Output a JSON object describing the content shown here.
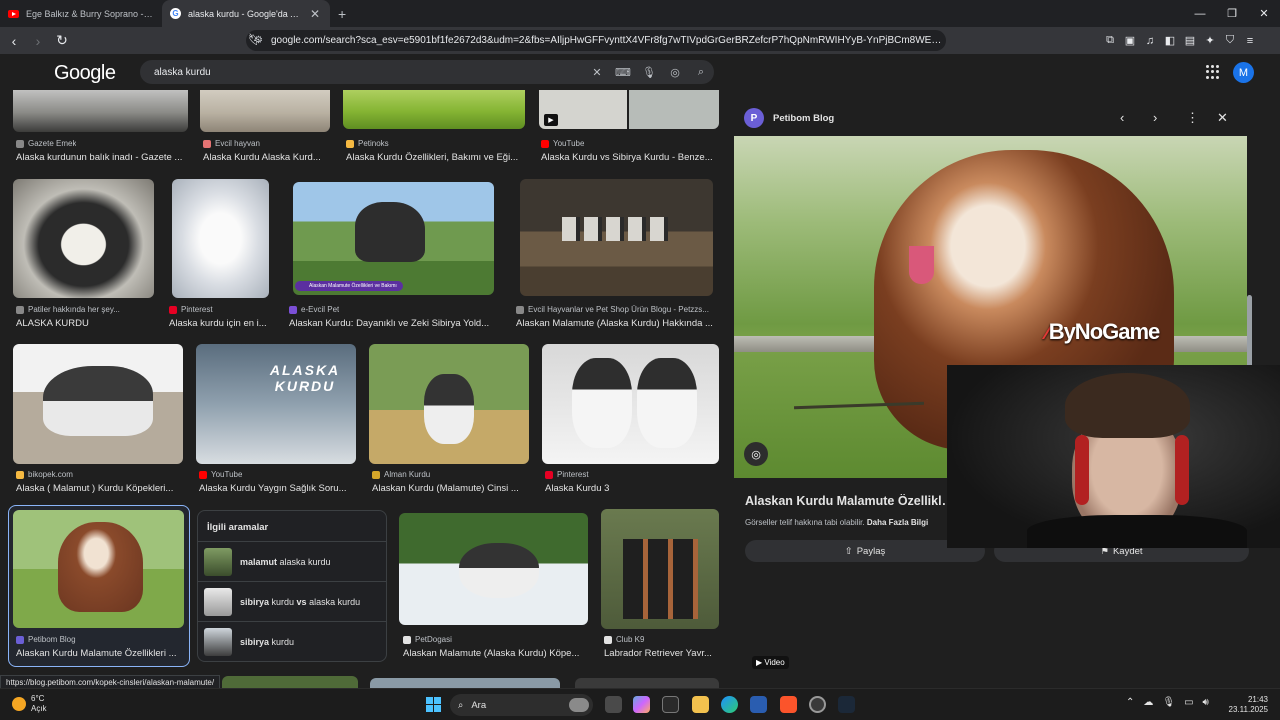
{
  "tabs": [
    {
      "title": "Ege Balkız & Burry Soprano - Affet Be",
      "active": false
    },
    {
      "title": "alaska kurdu - Google'da Ara",
      "active": true
    }
  ],
  "address_bar": {
    "url": "google.com/search?sca_esv=e5901bf1fe2672d3&udm=2&fbs=AIljpHwGFFvynttX4VFr8fg7wTIVpdGrGerBRZefcrP7hQpNmRWIHYyB-YnPjBCm8WEEt..."
  },
  "google": {
    "logo": "Google",
    "query": "alaska kurdu",
    "avatar_letter": "M"
  },
  "results": [
    {
      "source": "Gazete Emek",
      "title": "Alaska kurdunun balık inadı - Gazete ..."
    },
    {
      "source": "Evcil hayvan",
      "title": "Alaska Kurdu Alaska Kurd..."
    },
    {
      "source": "Petinoks",
      "title": "Alaska Kurdu Özellikleri, Bakımı ve Eği..."
    },
    {
      "source": "YouTube",
      "title": "Alaska Kurdu vs Sibirya Kurdu - Benze..."
    },
    {
      "source": "Patiler hakkında her şey...",
      "title": "ALASKA KURDU"
    },
    {
      "source": "Pinterest",
      "title": "Alaska kurdu için en i..."
    },
    {
      "source": "e-Evcil Pet",
      "title": "Alaskan Kurdu: Dayanıklı ve Zeki Sibirya Yold..."
    },
    {
      "source": "Evcil Hayvanlar ve Pet Shop Ürün Blogu - Petzzs...",
      "title": "Alaskan Malamute (Alaska Kurdu) Hakkında ..."
    },
    {
      "source": "bikopek.com",
      "title": "Alaska ( Malamut ) Kurdu Köpekleri..."
    },
    {
      "source": "YouTube",
      "title": "Alaska Kurdu Yaygın Sağlık Soru..."
    },
    {
      "source": "Alman Kurdu",
      "title": "Alaskan Kurdu (Malamute) Cinsi ..."
    },
    {
      "source": "Pinterest",
      "title": "Alaska Kurdu 3"
    },
    {
      "source": "Petibom Blog",
      "title": "Alaskan Kurdu Malamute Özellikleri ..."
    },
    {
      "source": "PetDogasi",
      "title": "Alaskan Malamute (Alaska Kurdu) Köpe..."
    },
    {
      "source": "Club K9",
      "title": "Labrador Retriever Yavr..."
    }
  ],
  "thumb_text": {
    "banner": "Alaskan Malamute Özellikleri ve Bakımı",
    "poster_title": "ALASKA KURDU"
  },
  "related": {
    "heading": "İlgili aramalar",
    "items": [
      {
        "bold": "malamut",
        "rest": " alaska kurdu"
      },
      {
        "bold": "sibirya",
        "rest": " kurdu ",
        "bold2": "vs",
        "rest2": " alaska kurdu"
      },
      {
        "bold": "sibirya",
        "rest": " kurdu"
      }
    ]
  },
  "panel": {
    "site": "Petibom Blog",
    "site_letter": "P",
    "title": "Alaskan Kurdu Malamute Özellikleri ve",
    "copyright": "Görseller telif hakkına tabi olabilir.",
    "more_info": "Daha Fazla Bilgi",
    "share": "Paylaş",
    "save": "Kaydet",
    "video_badge": "Video",
    "watermark": "ByNoGame"
  },
  "status_url": "https://blog.petibom.com/kopek-cinsleri/alaskan-malamute/",
  "taskbar": {
    "temp": "6°C",
    "weather": "Açık",
    "search": "Ara",
    "time": "21:43",
    "date": "23.11.2025"
  }
}
